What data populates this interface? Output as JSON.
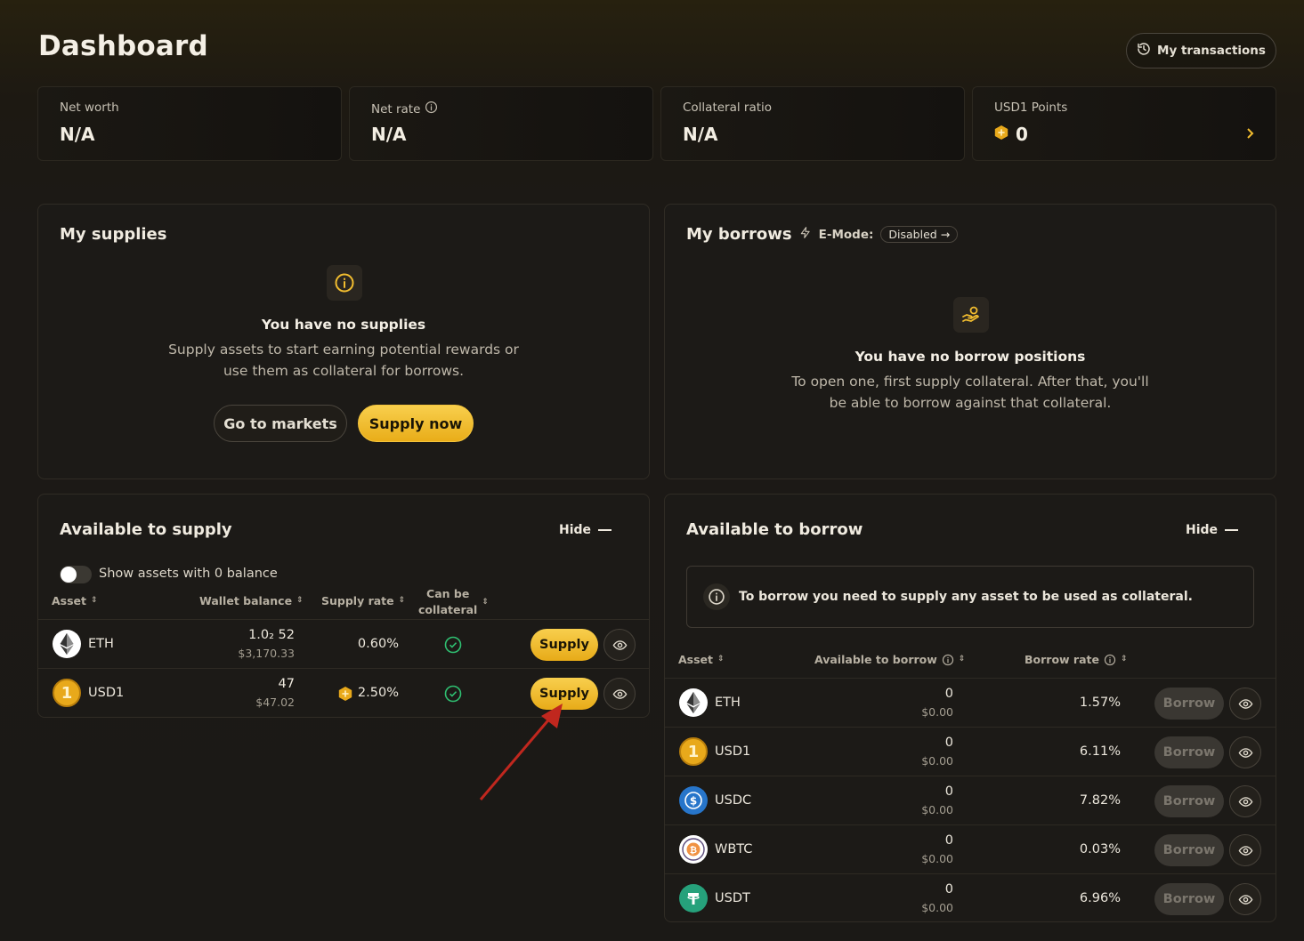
{
  "header": {
    "title": "Dashboard",
    "transactions_label": "My transactions"
  },
  "stats": [
    {
      "label": "Net worth",
      "value": "N/A"
    },
    {
      "label": "Net rate",
      "value": "N/A"
    },
    {
      "label": "Collateral ratio",
      "value": "N/A"
    },
    {
      "label": "USD1 Points",
      "value": "0"
    }
  ],
  "supplies": {
    "title": "My supplies",
    "empty_title": "You have no supplies",
    "empty_desc_1": "Supply assets to start earning potential rewards or",
    "empty_desc_2": "use them as collateral for borrows.",
    "markets_button": "Go to markets",
    "supply_button": "Supply now"
  },
  "borrows": {
    "title": "My borrows",
    "emode_label": "E-Mode:",
    "emode_status": "Disabled",
    "empty_title": "You have no borrow positions",
    "empty_desc_1": "To open one, first supply collateral. After that, you'll",
    "empty_desc_2": "be able to borrow against that collateral."
  },
  "available_supply": {
    "title": "Available to supply",
    "hide_label": "Hide",
    "toggle_label": "Show assets with 0 balance",
    "columns": {
      "asset": "Asset",
      "wallet": "Wallet balance",
      "rate": "Supply rate",
      "collateral_1": "Can be",
      "collateral_2": "collateral"
    },
    "rows": [
      {
        "asset": "ETH",
        "balance": "1.0₂ 52",
        "usd": "$3,170.33",
        "rate": "0.60%",
        "action": "Supply"
      },
      {
        "asset": "USD1",
        "balance": "47",
        "usd": "$47.02",
        "rate": "2.50%",
        "action": "Supply"
      }
    ]
  },
  "available_borrow": {
    "title": "Available to borrow",
    "hide_label": "Hide",
    "notice": "To borrow you need to supply any asset to be used as collateral.",
    "columns": {
      "asset": "Asset",
      "available": "Available to borrow",
      "rate": "Borrow rate"
    },
    "rows": [
      {
        "asset": "ETH",
        "amount": "0",
        "usd": "$0.00",
        "rate": "1.57%",
        "action": "Borrow"
      },
      {
        "asset": "USD1",
        "amount": "0",
        "usd": "$0.00",
        "rate": "6.11%",
        "action": "Borrow"
      },
      {
        "asset": "USDC",
        "amount": "0",
        "usd": "$0.00",
        "rate": "7.82%",
        "action": "Borrow"
      },
      {
        "asset": "WBTC",
        "amount": "0",
        "usd": "$0.00",
        "rate": "0.03%",
        "action": "Borrow"
      },
      {
        "asset": "USDT",
        "amount": "0",
        "usd": "$0.00",
        "rate": "6.96%",
        "action": "Borrow"
      }
    ]
  },
  "colors": {
    "accent": "#f2bd2f",
    "background": "#1b1916",
    "success": "#2fbf71",
    "annotation_arrow": "#c0271e"
  },
  "icons": {
    "eth": "ethereum-icon",
    "usd1": "usd1-coin-icon",
    "usdc": "usdc-coin-icon",
    "wbtc": "wbtc-coin-icon",
    "usdt": "usdt-coin-icon",
    "history": "history-icon",
    "info": "info-icon",
    "eye": "eye-icon",
    "check": "check-circle-icon",
    "points": "points-hexagon-icon"
  }
}
